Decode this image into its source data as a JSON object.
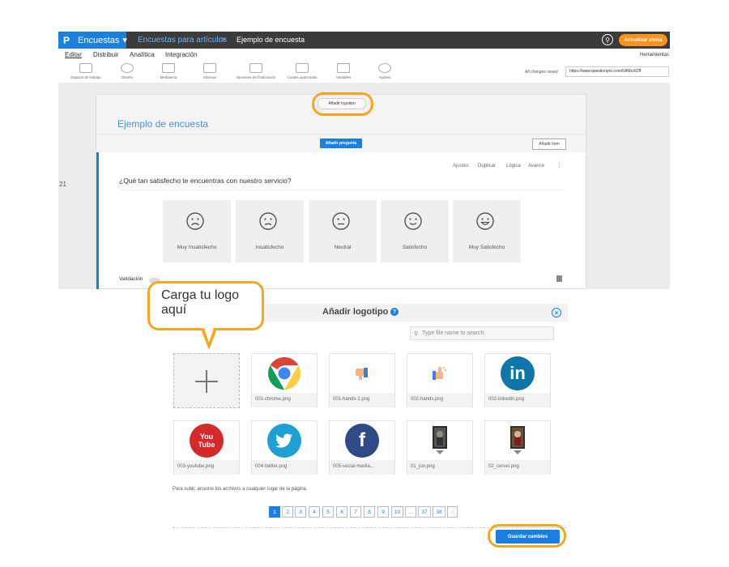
{
  "app": {
    "brand": "Encuestas",
    "breadcrumb": [
      "Encuestas para artículos",
      "Ejemplo de encuesta"
    ],
    "breadcrumb_sep": ">",
    "upgrade_label": "Actualizar ahora",
    "menu": [
      "Editar",
      "Distribuir",
      "Analítica",
      "Integración"
    ],
    "tools_label": "Herramientas",
    "toolbar": [
      "Espacio de trabajo",
      "Diseño",
      "Mediateca",
      "Idiomas",
      "Opciones de finalización",
      "Cuotas avanzadas",
      "Variables",
      "Ajustes"
    ],
    "saved_text": "All changes saved",
    "url": "https://www.questionpro.com/t/AMxXlZff"
  },
  "editor": {
    "side_number": "21",
    "add_logo_label": "Añadir logotipo",
    "survey_title": "Ejemplo de encuesta",
    "add_question_label": "Añadir pregunta",
    "add_item_label": "Añadir ítem",
    "question_actions": [
      "Ajustes",
      "Duplicar",
      "Lógica",
      "Avance"
    ],
    "question_more": "⋮",
    "question_text": "¿Qué tan satisfecho te encuentras con nuestro servicio?",
    "options": [
      "Muy Insatisfecho",
      "Insatisfecho",
      "Neutral",
      "Satisfecho",
      "Muy Satisfecho"
    ],
    "validation_label": "Validación"
  },
  "callout": {
    "text": "Carga tu logo aquí"
  },
  "dialog": {
    "title": "Añadir logotipo",
    "help_glyph": "?",
    "close_glyph": "×",
    "search_placeholder": "Type file name to search.",
    "files": [
      {
        "name": "001-chrome.png",
        "icon": "chrome-logo"
      },
      {
        "name": "001-hands-1.png",
        "icon": "thumbs-down-hand"
      },
      {
        "name": "002-hands.png",
        "icon": "thumbs-up-hand"
      },
      {
        "name": "002-linkedin.png",
        "icon": "linkedin-logo",
        "text": "in"
      },
      {
        "name": "003-youtube.png",
        "icon": "youtube-logo",
        "text": "You Tube"
      },
      {
        "name": "004-twitter.png",
        "icon": "twitter-logo"
      },
      {
        "name": "005-social-media...",
        "icon": "facebook-logo",
        "text": "f"
      },
      {
        "name": "01_jon.png",
        "icon": "portrait-photo"
      },
      {
        "name": "02_cersei.png",
        "icon": "portrait-photo"
      }
    ],
    "drop_note": "Para subir, arrastre los archivos a cualquier lugar de la página.",
    "pagination": [
      "1",
      "2",
      "3",
      "4",
      "5",
      "6",
      "7",
      "8",
      "9",
      "10",
      "...",
      "37",
      "38",
      ">"
    ],
    "current_page": "1",
    "save_label": "Guardar cambios"
  },
  "colors": {
    "accent": "#1b7fe0",
    "highlight": "#f5a623",
    "upgrade": "#f7931e",
    "topbar": "#3b3b3b"
  }
}
